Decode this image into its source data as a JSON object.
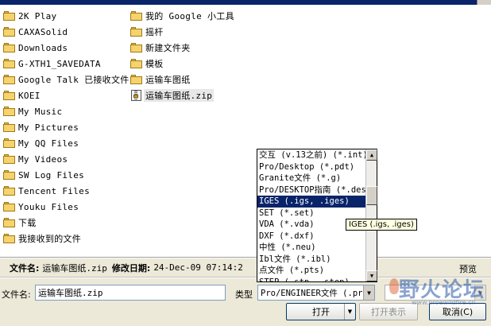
{
  "file_list": {
    "column1": [
      {
        "name": "2K Play",
        "icon": "folder-icon"
      },
      {
        "name": "CAXASolid",
        "icon": "folder-icon"
      },
      {
        "name": "Downloads",
        "icon": "folder-icon"
      },
      {
        "name": "G-XTH1_SAVEDATA",
        "icon": "folder-icon"
      },
      {
        "name": "Google Talk 已接收文件",
        "icon": "folder-icon"
      },
      {
        "name": "KOEI",
        "icon": "folder-icon"
      },
      {
        "name": "My Music",
        "icon": "folder-icon"
      },
      {
        "name": "My Pictures",
        "icon": "folder-icon"
      },
      {
        "name": "My QQ Files",
        "icon": "folder-icon"
      },
      {
        "name": "My Videos",
        "icon": "folder-icon"
      },
      {
        "name": "SW Log Files",
        "icon": "folder-icon"
      },
      {
        "name": "Tencent Files",
        "icon": "folder-icon"
      },
      {
        "name": "Youku Files",
        "icon": "folder-icon"
      },
      {
        "name": "下载",
        "icon": "folder-icon"
      },
      {
        "name": "我接收到的文件",
        "icon": "folder-icon"
      }
    ],
    "column2": [
      {
        "name": "我的 Google 小工具",
        "icon": "folder-icon"
      },
      {
        "name": "摇杆",
        "icon": "folder-icon"
      },
      {
        "name": "新建文件夹",
        "icon": "folder-icon"
      },
      {
        "name": "模板",
        "icon": "folder-icon"
      },
      {
        "name": "运输车图纸",
        "icon": "folder-icon"
      },
      {
        "name": "运输车图纸.zip",
        "icon": "zip-archive-icon",
        "selected": true
      }
    ]
  },
  "info_bar": {
    "filename_label": "文件名:",
    "filename_value": "运输车图纸.zip",
    "modified_label": "修改日期:",
    "modified_value": "24-Dec-09 07:14:2",
    "preview_label": "预览"
  },
  "bottom": {
    "filename_field_label": "文件名:",
    "filename_field_value": "运输车图纸.zip",
    "type_label": "类型",
    "type_value": "Pro/ENGINEER文件 (.prt",
    "open_button": "打开",
    "open_show_button": "打开表示",
    "cancel_button": "取消(C)"
  },
  "type_dropdown": {
    "options": [
      "交互 (v.13之前) (*.int)",
      "Pro/Desktop (*.pdt)",
      "Granite文件 (*.g)",
      "Pro/DESKTOP指南 (*.des",
      "IGES (.igs, .iges)",
      "SET (*.set)",
      "VDA (*.vda)",
      "DXF (*.dxf)",
      "中性 (*.neu)",
      "Ibl文件 (*.ibl)",
      "点文件 (*.pts)",
      "STEP (.stp, .step)"
    ],
    "selected_index": 4
  },
  "tooltip": {
    "text": "IGES (.igs, .iges)"
  },
  "watermark": {
    "text": "野火论坛",
    "sub": "www.proewildfire.cn"
  },
  "colors": {
    "selection": "#0a246a",
    "dialog_bg": "#ece9d8",
    "tooltip_bg": "#ffffe1"
  }
}
